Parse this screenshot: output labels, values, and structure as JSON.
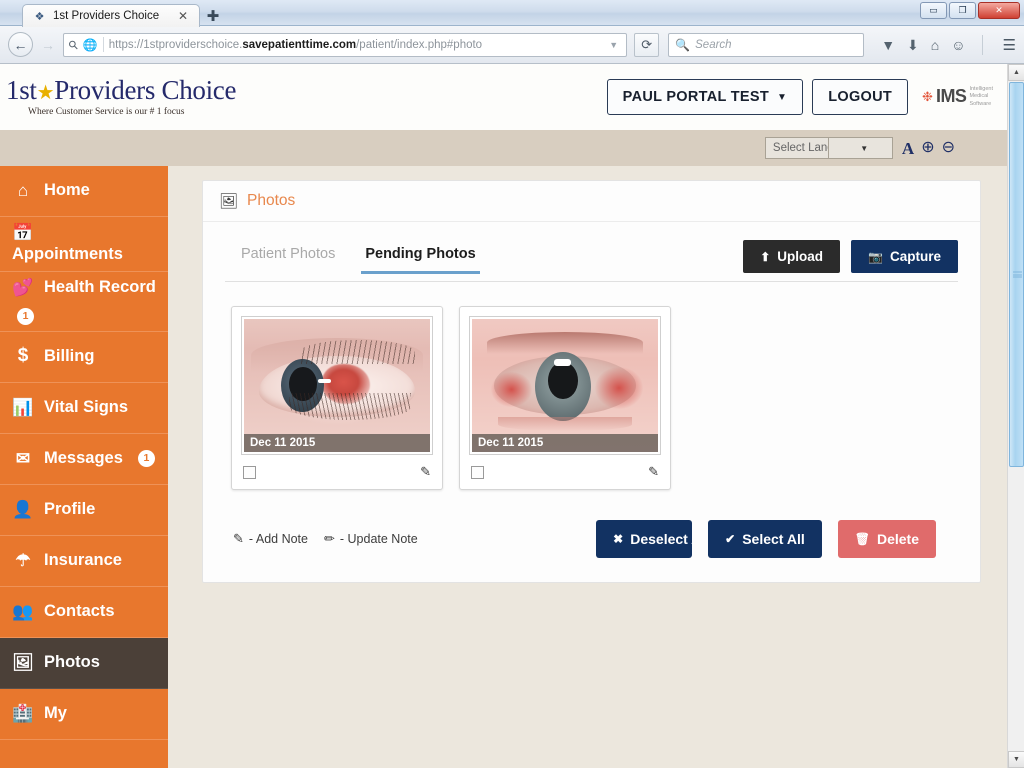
{
  "window": {
    "tab_title": "1st Providers Choice",
    "tab_close": "✕",
    "new_tab": "✚",
    "minimize": "▭",
    "restore": "❐",
    "close": "✕"
  },
  "navbar": {
    "back": "←",
    "forward": "→",
    "url_prefix": "https://1stproviderschoice.",
    "url_domain": "savepatienttime.com",
    "url_suffix": "/patient/index.php#photo",
    "url_dropdown": "▼",
    "reload": "⟳",
    "search_placeholder": "Search",
    "search_icon": "search-icon",
    "icons": [
      "pocket-icon",
      "download-icon",
      "home-icon",
      "chat-smiley-icon"
    ],
    "menu": "☰"
  },
  "site_header": {
    "logo_first": "1st",
    "logo_star": "★",
    "logo_rest": "Providers Choice",
    "tagline": "Where Customer Service is our # 1 focus",
    "user_button": "PAUL PORTAL TEST",
    "user_caret": "▼",
    "logout_button": "LOGOUT",
    "ims_name": "IMS",
    "ims_sub_line1": "Intelligent",
    "ims_sub_line2": "Medical",
    "ims_sub_line3": "Software"
  },
  "lang_bar": {
    "select_value": "Select Lang",
    "select_arrow": "▼",
    "reset_font": "A",
    "zoom_in": "⊕",
    "zoom_out": "⊖"
  },
  "sidebar": {
    "collapse_arrow": "❮",
    "items": [
      {
        "label": "Home",
        "icon": "home-icon",
        "glyph": "⌂",
        "badge": null,
        "active": false
      },
      {
        "label": "Appointments",
        "icon": "calendar-icon",
        "glyph": "▦",
        "badge": null,
        "active": false,
        "two_line": true
      },
      {
        "label": "Health Record",
        "icon": "heartbeat-icon",
        "glyph": "♥",
        "badge": "1",
        "active": false,
        "two_line": true
      },
      {
        "label": "Billing",
        "icon": "dollar-icon",
        "glyph": "$",
        "badge": null,
        "active": false
      },
      {
        "label": "Vital Signs",
        "icon": "bar-chart-icon",
        "glyph": "▂▅▇",
        "badge": null,
        "active": false
      },
      {
        "label": "Messages",
        "icon": "envelope-icon",
        "glyph": "✉",
        "badge": "1",
        "active": false
      },
      {
        "label": "Profile",
        "icon": "user-icon",
        "glyph": "👤",
        "badge": null,
        "active": false
      },
      {
        "label": "Insurance",
        "icon": "umbrella-icon",
        "glyph": "☂",
        "badge": null,
        "active": false
      },
      {
        "label": "Contacts",
        "icon": "group-icon",
        "glyph": "👥",
        "badge": null,
        "active": false
      },
      {
        "label": "Photos",
        "icon": "image-icon",
        "glyph": "🖼",
        "badge": null,
        "active": true
      },
      {
        "label": "My",
        "icon": "medical-kit-icon",
        "glyph": "✚",
        "badge": null,
        "active": false
      }
    ]
  },
  "panel": {
    "title": "Photos",
    "title_icon": "image-icon",
    "tabs": [
      {
        "label": "Patient Photos",
        "active": false
      },
      {
        "label": "Pending Photos",
        "active": true
      }
    ],
    "upload_button": "Upload",
    "upload_icon": "upload-icon",
    "capture_button": "Capture",
    "capture_icon": "camera-icon",
    "photos": [
      {
        "caption": "Dec 11 2015",
        "alt": "close-up of eye with subconjunctival hemorrhage",
        "checked": false,
        "note_icon": "add-note-icon"
      },
      {
        "caption": "Dec 11 2015",
        "alt": "close-up of red inflamed eye",
        "checked": false,
        "note_icon": "add-note-icon"
      }
    ],
    "legend": [
      {
        "icon": "add-note-icon",
        "glyph": "✎",
        "text": "- Add Note"
      },
      {
        "icon": "update-note-icon",
        "glyph": "✎",
        "text": "- Update Note"
      }
    ],
    "deselect_all": "Deselect All",
    "deselect_icon": "✖",
    "select_all": "Select All",
    "select_icon": "✔",
    "delete": "Delete",
    "delete_icon": "🗑"
  },
  "scrollbar": {
    "up": "▲",
    "down": "▼"
  },
  "colors": {
    "sidebar_orange": "#e8772d",
    "sidebar_active": "#4b4038",
    "panel_title": "#e8884d",
    "tab_underline": "#6aa0cc",
    "navy_button": "#123262",
    "dark_button": "#2b2b2b",
    "delete_red": "#e06b6b",
    "content_bg": "#ece7dd",
    "lang_bar": "#d8cec0"
  }
}
